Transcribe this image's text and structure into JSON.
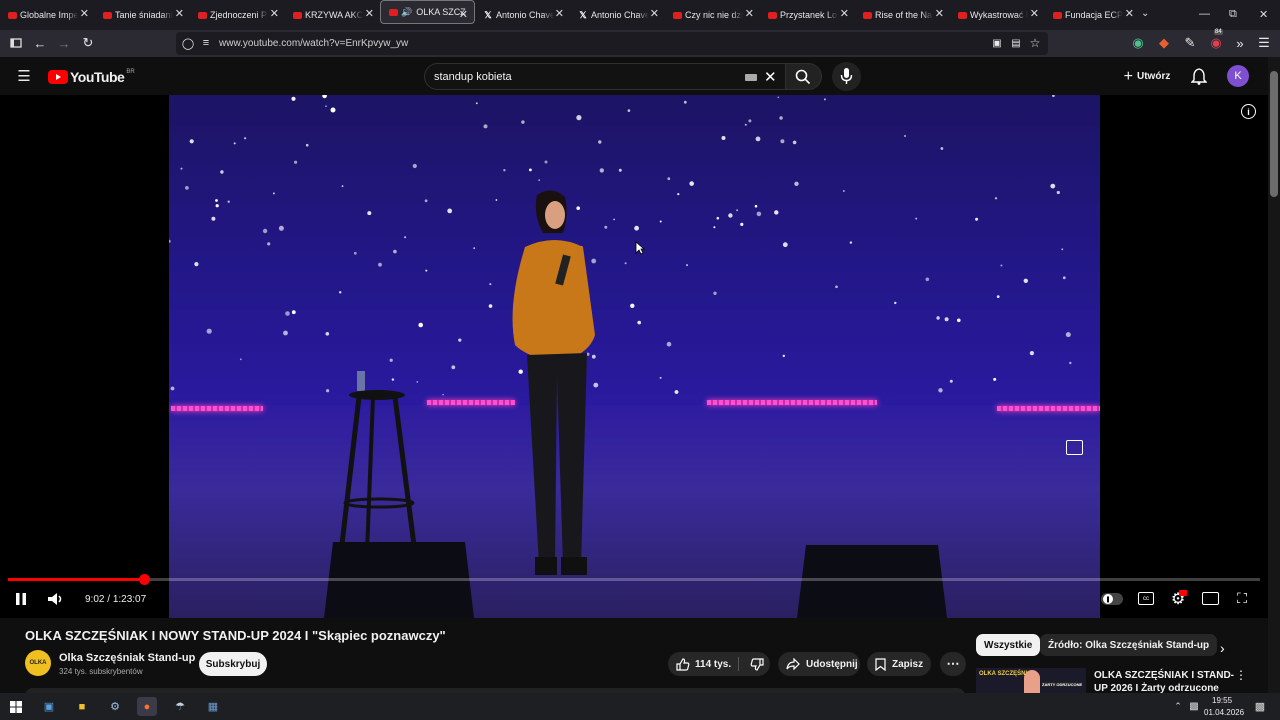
{
  "tabs": [
    {
      "title": "Globalne Imper",
      "icon": "youtube-icon"
    },
    {
      "title": "Tanie śniadanie",
      "icon": "youtube-icon"
    },
    {
      "title": "Zjednoczeni Prz",
      "icon": "youtube-icon"
    },
    {
      "title": "KRZYWA AKCJA",
      "icon": "youtube-icon"
    },
    {
      "title": "OLKA SZCZ",
      "icon": "youtube-icon",
      "active": true,
      "audio": true
    },
    {
      "title": "Antonio Chavez",
      "icon": "x-icon"
    },
    {
      "title": "Antonio Chavez",
      "icon": "x-icon"
    },
    {
      "title": "Czy nic nie dzie",
      "icon": "youtube-icon"
    },
    {
      "title": "Przystanek Lom",
      "icon": "youtube-icon"
    },
    {
      "title": "Rise of the Nazi",
      "icon": "youtube-icon"
    },
    {
      "title": "Wykastrować b",
      "icon": "youtube-icon"
    },
    {
      "title": "Fundacja ECPU",
      "icon": "youtube-icon"
    }
  ],
  "browser": {
    "url": "www.youtube.com/watch?v=EnrKpvyw_yw",
    "extension_badge": "84"
  },
  "youtube": {
    "logo_text": "YouTube",
    "region": "BR",
    "search_value": "standup kobieta",
    "create_label": "Utwórz",
    "avatar_letter": "K"
  },
  "player": {
    "current_time": "9:02",
    "duration": "1:23:07",
    "progress_fraction": 0.1087
  },
  "video": {
    "title": "OLKA SZCZĘŚNIAK I NOWY STAND-UP 2024 I \"Skąpiec poznawczy\"",
    "channel": "Olka Szczęśniak Stand-up",
    "channel_avatar_text": "OLKA",
    "subscribers": "324 tys. subskrybentów",
    "subscribe_label": "Subskrybuj",
    "likes": "114 tys.",
    "share_label": "Udostępnij",
    "save_label": "Zapisz"
  },
  "sidebar": {
    "chip_all": "Wszystkie",
    "chip_source": "Źródło: Olka Szczęśniak Stand-up",
    "rec_title": "OLKA SZCZĘŚNIAK I STAND-UP 2026 I Żarty odrzucone",
    "rec_thumb_text": "OLKA SZCZĘŚNIAK",
    "rec_thumb_sub": "ŻARTY ODRZUCONE"
  },
  "taskbar": {
    "time": "19:55",
    "date": "01.04.2026"
  },
  "colors": {
    "accent_red": "#ff0000",
    "page_bg": "#0f0f0f",
    "avatar": "#7e4fd0"
  }
}
